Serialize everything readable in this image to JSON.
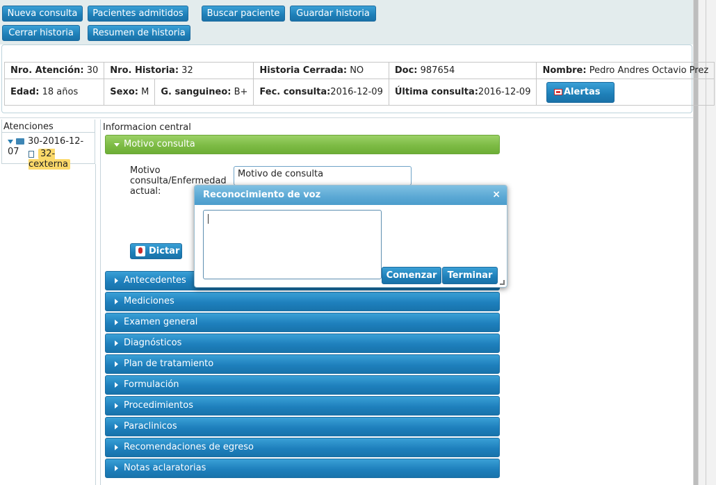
{
  "toolbar": {
    "nueva_consulta": "Nueva consulta",
    "pacientes_admitidos": "Pacientes admitidos",
    "buscar_paciente": "Buscar paciente",
    "guardar_historia": "Guardar historia",
    "cerrar_historia": "Cerrar historia",
    "resumen_historia": "Resumen de historia"
  },
  "patient": {
    "nro_atencion_label": "Nro. Atención:",
    "nro_atencion": "30",
    "nro_historia_label": "Nro. Historia:",
    "nro_historia": "32",
    "historia_cerrada_label": "Historia Cerrada:",
    "historia_cerrada": "NO",
    "doc_label": "Doc:",
    "doc": "987654",
    "nombre_label": "Nombre:",
    "nombre": "Pedro Andres Octavio Prez",
    "edad_label": "Edad:",
    "edad": "18 años",
    "sexo_label": "Sexo:",
    "sexo": "M",
    "sangre_label": "G. sanguineo:",
    "sangre": "B+",
    "fec_consulta_label": "Fec. consulta:",
    "fec_consulta": "2016-12-09",
    "ultima_consulta_label": "Última consulta:",
    "ultima_consulta": "2016-12-09",
    "alertas": "Alertas"
  },
  "tree": {
    "title": "Atenciones",
    "node": "30-2016-12-07",
    "child": "32-cexterna"
  },
  "center": {
    "title": "Informacion central",
    "open_section": "Motivo consulta",
    "motivo_label": "Motivo consulta/Enfermedad actual:",
    "motivo_value": "Motivo de consulta",
    "dictar": "Dictar",
    "sections": [
      "Antecedentes",
      "Mediciones",
      "Examen general",
      "Diagnósticos",
      "Plan de tratamiento",
      "Formulación",
      "Procedimientos",
      "Paraclinicos",
      "Recomendaciones de egreso",
      "Notas aclaratorias"
    ]
  },
  "dialog": {
    "title": "Reconocimiento de voz",
    "close": "×",
    "comenzar": "Comenzar",
    "terminar": "Terminar"
  }
}
